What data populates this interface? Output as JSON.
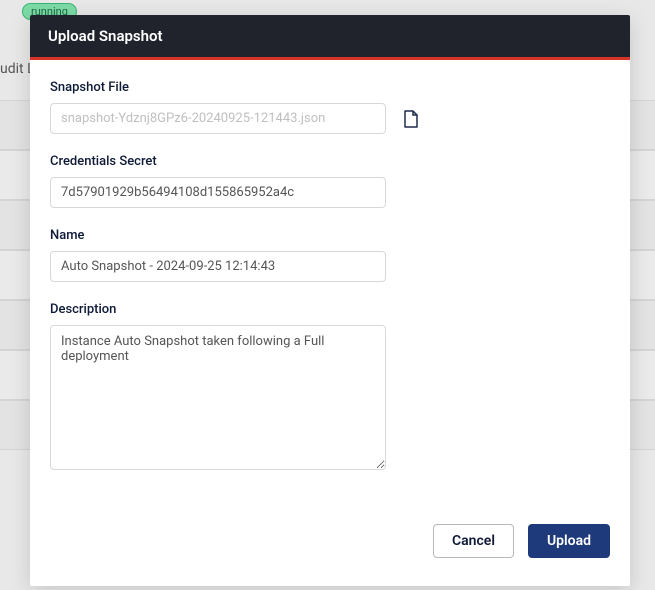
{
  "background": {
    "badge": "running",
    "tab": "udit L"
  },
  "modal": {
    "title": "Upload Snapshot",
    "snapshot_file": {
      "label": "Snapshot File",
      "placeholder": "snapshot-Ydznj8GPz6-20240925-121443.json"
    },
    "credentials_secret": {
      "label": "Credentials Secret",
      "value": "7d57901929b56494108d155865952a4c"
    },
    "name": {
      "label": "Name",
      "value": "Auto Snapshot - 2024-09-25 12:14:43"
    },
    "description": {
      "label": "Description",
      "value": "Instance Auto Snapshot taken following a Full deployment"
    },
    "cancel_label": "Cancel",
    "upload_label": "Upload"
  }
}
